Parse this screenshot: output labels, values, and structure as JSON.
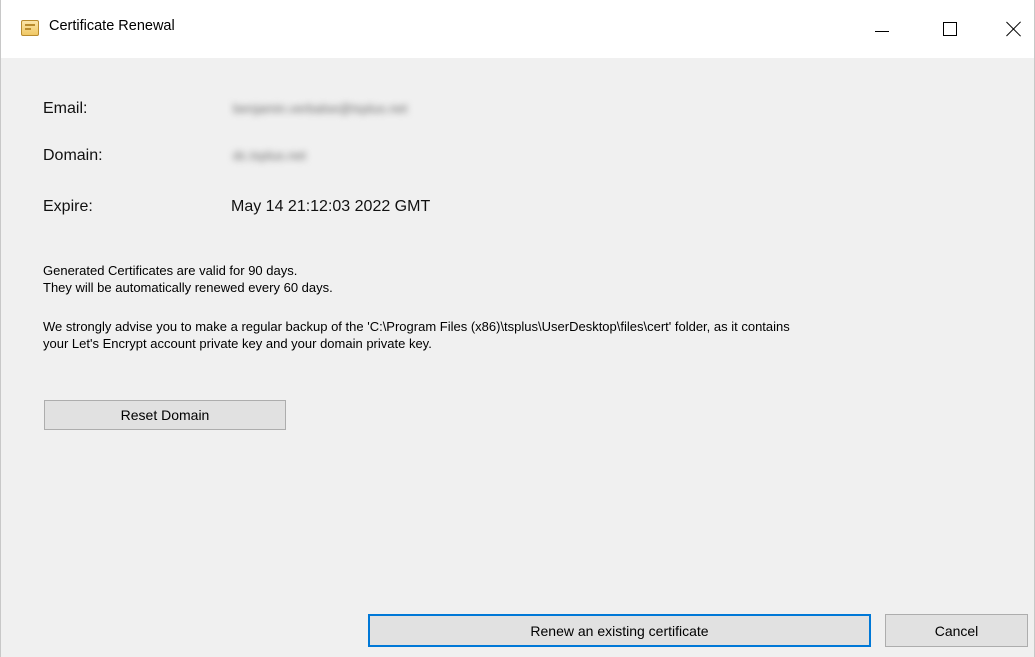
{
  "window": {
    "title": "Certificate Renewal"
  },
  "fields": {
    "email_label": "Email:",
    "email_value": "benjamin.verbalse@tsplus.net",
    "domain_label": "Domain:",
    "domain_value": "dc.tsplus.net",
    "expire_label": "Expire:",
    "expire_value": "May 14 21:12:03 2022 GMT"
  },
  "notes": {
    "line1": "Generated Certificates are valid for 90 days.",
    "line2": "They will be automatically renewed every 60 days.",
    "line3": "We strongly advise you to make a regular backup of the 'C:\\Program Files (x86)\\tsplus\\UserDesktop\\files\\cert' folder, as it contains",
    "line4": "your Let's Encrypt account private key and your domain private key."
  },
  "buttons": {
    "reset_domain": "Reset Domain",
    "renew": "Renew an existing certificate",
    "cancel": "Cancel"
  },
  "icons": {
    "app": "certificate-icon",
    "minimize": "minimize-icon",
    "maximize": "maximize-icon",
    "close": "close-icon"
  },
  "colors": {
    "window_bg": "#f0f0f0",
    "titlebar_bg": "#ffffff",
    "button_bg": "#e1e1e1",
    "default_button_border": "#0078d7"
  }
}
